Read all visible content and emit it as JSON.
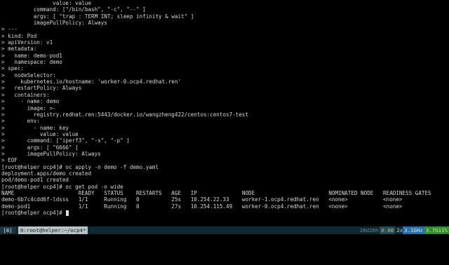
{
  "terminal": {
    "lines": [
      "                value: value",
      "          command: [\"/bin/bash\", \"-c\", \"--\" ]",
      "          args: [ \"trap : TERM INT; sleep infinity & wait\" ]",
      "          imagePullPolicy: Always",
      "> ---",
      "> kind: Pod",
      "> apiVersion: v1",
      "> metadata:",
      ">   name: demo-pod1",
      ">   namespace: demo",
      "> spec:",
      ">   nodeSelector:",
      ">     kubernetes.io/hostname: 'worker-0.ocp4.redhat.ren'",
      ">   restartPolicy: Always",
      ">   containers:",
      ">     - name: demo",
      ">       image: >-",
      ">         registry.redhat.ren:5443/docker.io/wangzheng422/centos:centos7-test",
      ">       env:",
      ">         - name: key",
      ">           value: value",
      ">       command: [\"iperf3\", \"-s\", \"-p\" ]",
      ">       args: [ \"6666\" ]",
      ">       imagePullPolicy: Always",
      "> EOF",
      "[root@helper ocp4]# oc apply -n demo -f demo.yaml",
      "deployment.apps/demo created",
      "pod/demo-pod1 created",
      "[root@helper ocp4]# oc get pod -o wide",
      "NAME                    READY   STATUS    RESTARTS   AGE   IP              NODE                       NOMINATED NODE   READINESS GATES",
      "demo-6b7c4cdd6f-ldsss   1/1     Running   0          25s   10.254.22.33    worker-1.ocp4.redhat.ren   <none>           <none>",
      "demo-pod1               1/1     Running   0          27s   10.254.115.49   worker-0.ocp4.redhat.ren   <none>           <none>",
      "[root@helper ocp4]# "
    ]
  },
  "statusbar": {
    "session": "[8]",
    "window": "0:root@helper:~/ocp4*",
    "uptime": "28d20h",
    "load": "0.08",
    "cpu_count": "2x",
    "cpu_freq": "3.1GHz",
    "memory": "3.7G11%"
  }
}
